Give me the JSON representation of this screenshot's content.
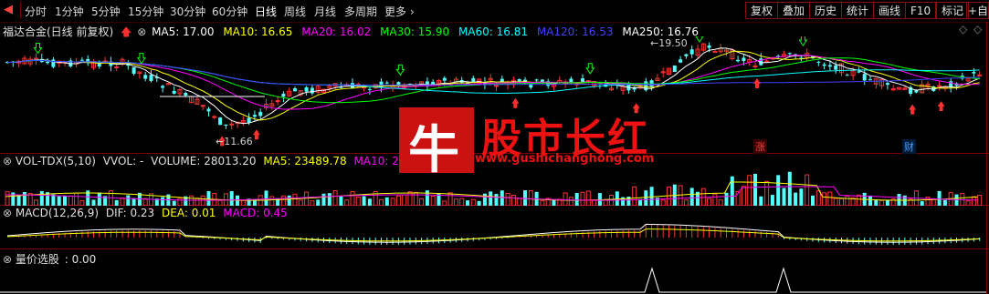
{
  "toolbar": {
    "back_icon": "left-arrow-icon",
    "periods": [
      "分时",
      "1分钟",
      "5分钟",
      "15分钟",
      "30分钟",
      "60分钟",
      "日线",
      "周线",
      "月线",
      "多周期",
      "更多"
    ],
    "more_arrow": "›",
    "right_buttons": [
      "复权",
      "叠加",
      "历史",
      "统计",
      "画线",
      "F10",
      "标记",
      "+自"
    ]
  },
  "main_chart": {
    "stock_name": "福达合金(日线 前复权)",
    "ma": [
      {
        "label": "MA5: 17.00",
        "color": "#ffffff"
      },
      {
        "label": "MA10: 16.65",
        "color": "#ffff00"
      },
      {
        "label": "MA20: 16.02",
        "color": "#ff00ff"
      },
      {
        "label": "MA30: 15.90",
        "color": "#00ff00"
      },
      {
        "label": "MA60: 16.81",
        "color": "#00ffff"
      },
      {
        "label": "MA120: 16.53",
        "color": "#4040ff"
      },
      {
        "label": "MA250: 16.76",
        "color": "#ffffff"
      }
    ],
    "high_label": "19.50",
    "low_label": "11.66",
    "tag_zhang": "涨",
    "tag_cai": "财",
    "diamond_icon": "diamond-icon",
    "up_arrow_icon": "red-up-arrow-icon"
  },
  "volume_panel": {
    "title": "VOL-TDX(5,10)",
    "vvol": "VVOL: -",
    "volume": "VOLUME: 28013.20",
    "ma5": "MA5: 23489.78",
    "ma10": "MA10: 24696.85"
  },
  "macd_panel": {
    "title": "MACD(12,26,9)",
    "dif": "DIF: 0.23",
    "dea": "DEA: 0.01",
    "macd": "MACD: 0.45"
  },
  "select_panel": {
    "title": "量价选股",
    "value": ": 0.00"
  },
  "watermark": {
    "logo_char": "牛",
    "text": "股市长红",
    "url": "www.gushichanghong.com"
  },
  "colors": {
    "up": "#ff3232",
    "down": "#54ffff",
    "border": "#7a0000"
  }
}
